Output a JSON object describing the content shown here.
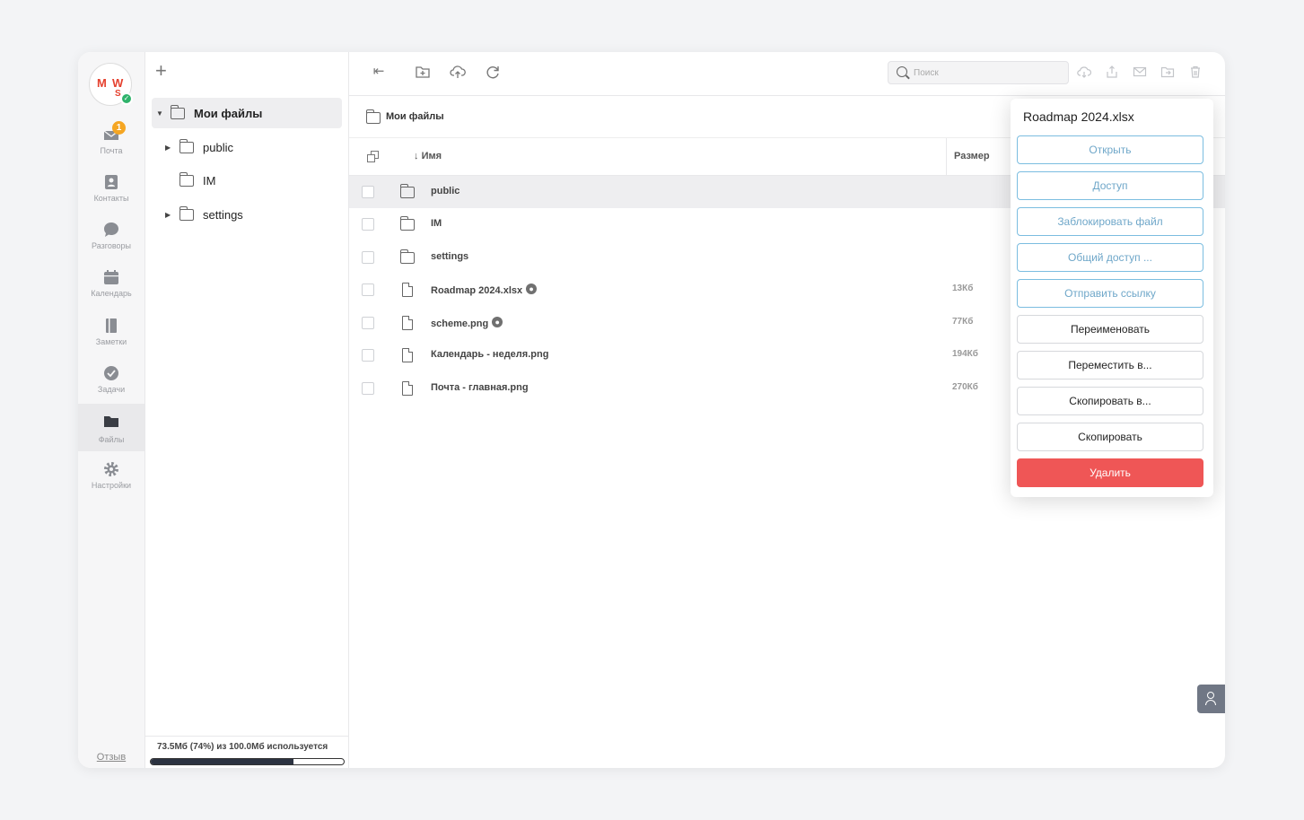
{
  "user": {
    "initials": [
      "M",
      "W",
      "S"
    ]
  },
  "nav": {
    "items": [
      {
        "label": "Почта",
        "icon": "mail-icon",
        "badge": "1"
      },
      {
        "label": "Контакты",
        "icon": "contacts-icon"
      },
      {
        "label": "Разговоры",
        "icon": "chat-icon"
      },
      {
        "label": "Календарь",
        "icon": "calendar-icon"
      },
      {
        "label": "Заметки",
        "icon": "notes-icon"
      },
      {
        "label": "Задачи",
        "icon": "tasks-icon"
      },
      {
        "label": "Файлы",
        "icon": "folder-icon",
        "active": true
      },
      {
        "label": "Настройки",
        "icon": "gear-icon"
      }
    ],
    "feedback": "Отзыв"
  },
  "tree": {
    "root": "Мои файлы",
    "children": [
      "public",
      "IM",
      "settings"
    ],
    "quota_text": "73.5Мб (74%) из 100.0Мб используется",
    "quota_fraction": 0.74
  },
  "search": {
    "placeholder": "Поиск"
  },
  "breadcrumb": "Мои файлы",
  "table": {
    "col_name": "Имя",
    "col_size": "Размер",
    "rows": [
      {
        "name": "public",
        "type": "folder",
        "size": ""
      },
      {
        "name": "IM",
        "type": "folder",
        "size": ""
      },
      {
        "name": "settings",
        "type": "folder",
        "size": ""
      },
      {
        "name": "Roadmap 2024.xlsx",
        "type": "file",
        "size": "13Кб",
        "shared": true
      },
      {
        "name": "scheme.png",
        "type": "file",
        "size": "77Кб",
        "shared": true
      },
      {
        "name": "Календарь - неделя.png",
        "type": "file",
        "size": "194Кб"
      },
      {
        "name": "Почта - главная.png",
        "type": "file",
        "size": "270Кб"
      }
    ]
  },
  "menu": {
    "title": "Roadmap 2024.xlsx",
    "items": [
      {
        "label": "Открыть",
        "style": "blue"
      },
      {
        "label": "Доступ",
        "style": "blue"
      },
      {
        "label": "Заблокировать файл",
        "style": "blue"
      },
      {
        "label": "Общий доступ ...",
        "style": "blue"
      },
      {
        "label": "Отправить ссылку",
        "style": "blue"
      },
      {
        "label": "Переименовать",
        "style": "plain"
      },
      {
        "label": "Переместить в...",
        "style": "plain"
      },
      {
        "label": "Скопировать в...",
        "style": "plain"
      },
      {
        "label": "Скопировать",
        "style": "plain"
      },
      {
        "label": "Удалить",
        "style": "danger"
      }
    ]
  },
  "colors": {
    "danger": "#ef5656",
    "accent": "#7bbde0",
    "badge": "#f5a623",
    "online": "#2fb36b"
  }
}
